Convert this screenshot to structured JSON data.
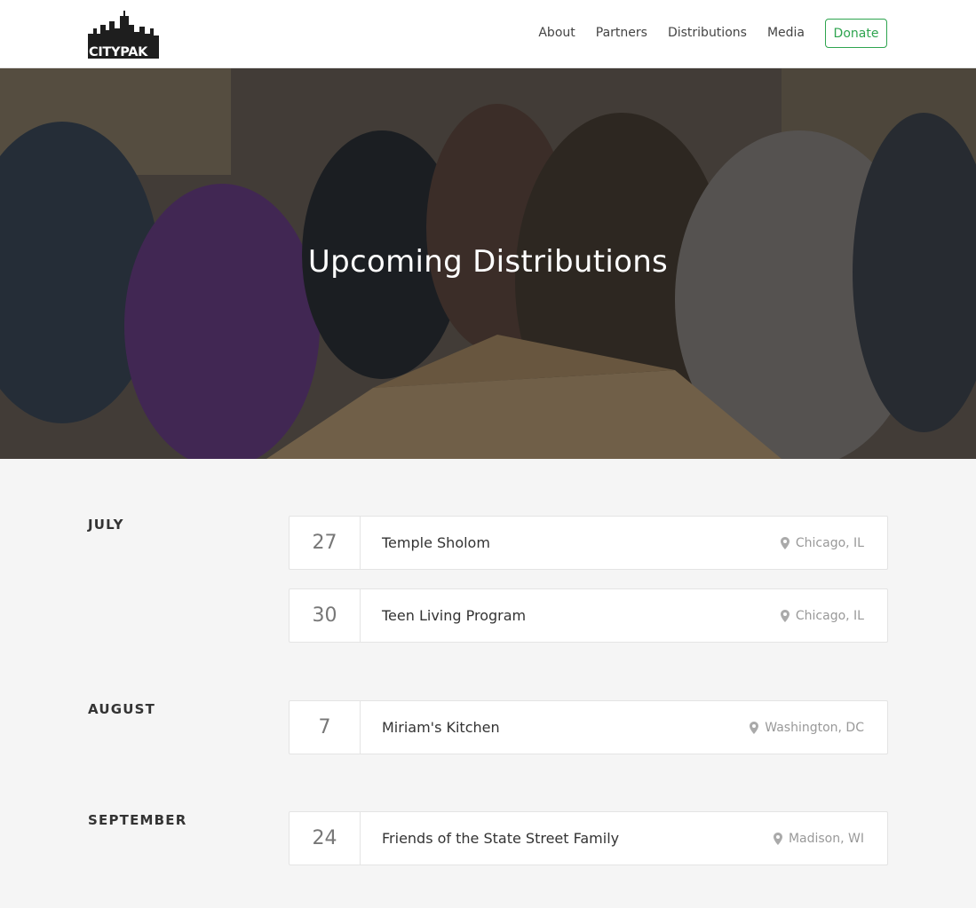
{
  "brand": {
    "logo_text": "CITYPAK"
  },
  "nav": {
    "items": [
      "About",
      "Partners",
      "Distributions",
      "Media"
    ],
    "donate_label": "Donate",
    "accent": "#2ea44f"
  },
  "hero": {
    "title": "Upcoming Distributions"
  },
  "months": [
    {
      "name": "JULY",
      "events": [
        {
          "day": "27",
          "name": "Temple Sholom",
          "location": "Chicago, IL"
        },
        {
          "day": "30",
          "name": "Teen Living Program",
          "location": "Chicago, IL"
        }
      ]
    },
    {
      "name": "AUGUST",
      "events": [
        {
          "day": "7",
          "name": "Miriam's Kitchen",
          "location": "Washington, DC"
        }
      ]
    },
    {
      "name": "SEPTEMBER",
      "events": [
        {
          "day": "24",
          "name": "Friends of the State Street Family",
          "location": "Madison, WI"
        }
      ]
    }
  ],
  "icons": {
    "location": "map-pin-icon"
  }
}
